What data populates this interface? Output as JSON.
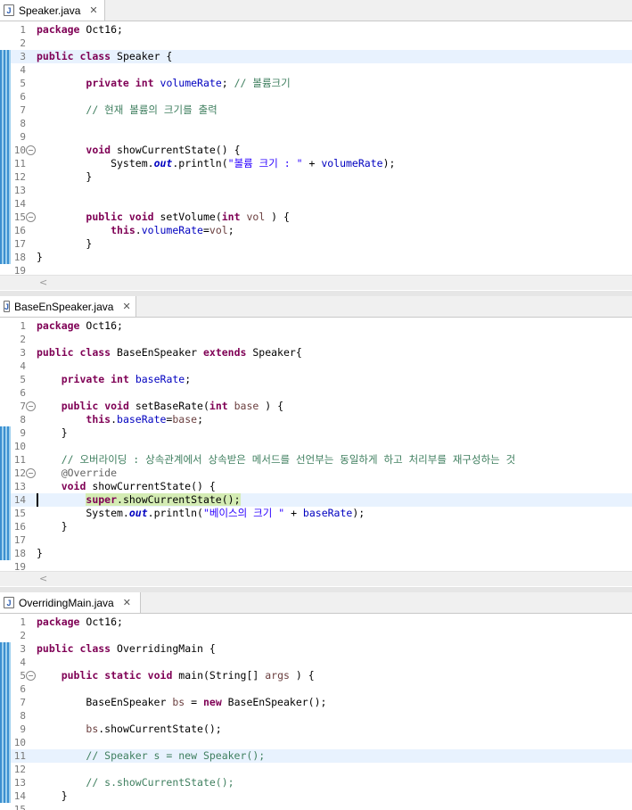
{
  "editors": [
    {
      "tab": "Speaker.java",
      "lines": [
        {
          "n": "1",
          "parts": [
            [
              "kw",
              "package"
            ],
            [
              "",
              "&nbsp;Oct16;"
            ]
          ]
        },
        {
          "n": "2",
          "parts": []
        },
        {
          "n": "3",
          "hl": true,
          "parts": [
            [
              "kw",
              "public"
            ],
            [
              "",
              " "
            ],
            [
              "kw",
              "class"
            ],
            [
              "",
              " Speaker {"
            ]
          ]
        },
        {
          "n": "4",
          "parts": []
        },
        {
          "n": "5",
          "parts": [
            [
              "",
              "        "
            ],
            [
              "kw",
              "private"
            ],
            [
              "",
              " "
            ],
            [
              "kw",
              "int"
            ],
            [
              "",
              " "
            ],
            [
              "fld",
              "volumeRate"
            ],
            [
              "",
              "; "
            ],
            [
              "cm",
              "// 볼륨크기"
            ]
          ]
        },
        {
          "n": "6",
          "parts": []
        },
        {
          "n": "7",
          "parts": [
            [
              "",
              "        "
            ],
            [
              "cm",
              "// 현재 볼륨의 크기를 출력"
            ]
          ]
        },
        {
          "n": "8",
          "parts": []
        },
        {
          "n": "9",
          "parts": []
        },
        {
          "n": "10",
          "fold": true,
          "parts": [
            [
              "",
              "        "
            ],
            [
              "kw",
              "void"
            ],
            [
              "",
              " showCurrentState() {"
            ]
          ]
        },
        {
          "n": "11",
          "parts": [
            [
              "",
              "            System."
            ],
            [
              "st",
              "out"
            ],
            [
              "",
              ".println("
            ],
            [
              "str",
              "\"볼륨 크기 : \""
            ],
            [
              "",
              " + "
            ],
            [
              "fld",
              "volumeRate"
            ],
            [
              "",
              ");"
            ]
          ]
        },
        {
          "n": "12",
          "parts": [
            [
              "",
              "        }"
            ]
          ]
        },
        {
          "n": "13",
          "parts": []
        },
        {
          "n": "14",
          "parts": []
        },
        {
          "n": "15",
          "fold": true,
          "parts": [
            [
              "",
              "        "
            ],
            [
              "kw",
              "public"
            ],
            [
              "",
              " "
            ],
            [
              "kw",
              "void"
            ],
            [
              "",
              " setVolume("
            ],
            [
              "kw",
              "int"
            ],
            [
              "",
              " "
            ],
            [
              "var",
              "vol"
            ],
            [
              "",
              " ) {"
            ]
          ]
        },
        {
          "n": "16",
          "parts": [
            [
              "",
              "            "
            ],
            [
              "kw",
              "this"
            ],
            [
              "",
              "."
            ],
            [
              "fld",
              "volumeRate"
            ],
            [
              "",
              "="
            ],
            [
              "var",
              "vol"
            ],
            [
              "",
              ";"
            ]
          ]
        },
        {
          "n": "17",
          "parts": [
            [
              "",
              "        }"
            ]
          ]
        },
        {
          "n": "18",
          "parts": [
            [
              "",
              "}"
            ]
          ]
        },
        {
          "n": "19",
          "parts": []
        }
      ]
    },
    {
      "tab": "BaseEnSpeaker.java",
      "lines": [
        {
          "n": "1",
          "parts": [
            [
              "kw",
              "package"
            ],
            [
              "",
              " Oct16;"
            ]
          ]
        },
        {
          "n": "2",
          "parts": []
        },
        {
          "n": "3",
          "parts": [
            [
              "kw",
              "public"
            ],
            [
              "",
              " "
            ],
            [
              "kw",
              "class"
            ],
            [
              "",
              " BaseEnSpeaker "
            ],
            [
              "kw",
              "extends"
            ],
            [
              "",
              " Speaker{"
            ]
          ]
        },
        {
          "n": "4",
          "parts": []
        },
        {
          "n": "5",
          "parts": [
            [
              "",
              "    "
            ],
            [
              "kw",
              "private"
            ],
            [
              "",
              " "
            ],
            [
              "kw",
              "int"
            ],
            [
              "",
              " "
            ],
            [
              "fld",
              "baseRate"
            ],
            [
              "",
              ";"
            ]
          ]
        },
        {
          "n": "6",
          "parts": []
        },
        {
          "n": "7",
          "fold": true,
          "parts": [
            [
              "",
              "    "
            ],
            [
              "kw",
              "public"
            ],
            [
              "",
              " "
            ],
            [
              "kw",
              "void"
            ],
            [
              "",
              " setBaseRate("
            ],
            [
              "kw",
              "int"
            ],
            [
              "",
              " "
            ],
            [
              "var",
              "base"
            ],
            [
              "",
              " ) {"
            ]
          ]
        },
        {
          "n": "8",
          "parts": [
            [
              "",
              "        "
            ],
            [
              "kw",
              "this"
            ],
            [
              "",
              "."
            ],
            [
              "fld",
              "baseRate"
            ],
            [
              "",
              "="
            ],
            [
              "var",
              "base"
            ],
            [
              "",
              ";"
            ]
          ]
        },
        {
          "n": "9",
          "parts": [
            [
              "",
              "    }"
            ]
          ]
        },
        {
          "n": "10",
          "parts": []
        },
        {
          "n": "11",
          "parts": [
            [
              "",
              "    "
            ],
            [
              "cm",
              "// 오버라이딩 : 상속관계에서 상속받은 메서드를 선언부는 동일하게 하고 처리부를 재구성하는 것"
            ]
          ]
        },
        {
          "n": "12",
          "fold": true,
          "parts": [
            [
              "",
              "    "
            ],
            [
              "ann",
              "@Override"
            ]
          ]
        },
        {
          "n": "13",
          "parts": [
            [
              "",
              "    "
            ],
            [
              "kw",
              "void"
            ],
            [
              "",
              " showCurrentState() {"
            ]
          ]
        },
        {
          "n": "14",
          "hl": true,
          "caret": true,
          "parts": [
            [
              "",
              "        "
            ],
            [
              "kw sel",
              "super"
            ],
            [
              "sel",
              ".showCurrentState();"
            ]
          ]
        },
        {
          "n": "15",
          "parts": [
            [
              "",
              "        System."
            ],
            [
              "st",
              "out"
            ],
            [
              "",
              ".println("
            ],
            [
              "str",
              "\"베이스의 크기 \""
            ],
            [
              "",
              " + "
            ],
            [
              "fld",
              "baseRate"
            ],
            [
              "",
              ");"
            ]
          ]
        },
        {
          "n": "16",
          "parts": [
            [
              "",
              "    }"
            ]
          ]
        },
        {
          "n": "17",
          "parts": []
        },
        {
          "n": "18",
          "parts": [
            [
              "",
              "}"
            ]
          ]
        },
        {
          "n": "19",
          "parts": []
        }
      ]
    },
    {
      "tab": "OverridingMain.java",
      "lines": [
        {
          "n": "1",
          "parts": [
            [
              "kw",
              "package"
            ],
            [
              "",
              " Oct16;"
            ]
          ]
        },
        {
          "n": "2",
          "parts": []
        },
        {
          "n": "3",
          "parts": [
            [
              "kw",
              "public"
            ],
            [
              "",
              " "
            ],
            [
              "kw",
              "class"
            ],
            [
              "",
              " OverridingMain {"
            ]
          ]
        },
        {
          "n": "4",
          "parts": []
        },
        {
          "n": "5",
          "fold": true,
          "parts": [
            [
              "",
              "    "
            ],
            [
              "kw",
              "public"
            ],
            [
              "",
              " "
            ],
            [
              "kw",
              "static"
            ],
            [
              "",
              " "
            ],
            [
              "kw",
              "void"
            ],
            [
              "",
              " main(String[] "
            ],
            [
              "var",
              "args"
            ],
            [
              "",
              " ) {"
            ]
          ]
        },
        {
          "n": "6",
          "parts": []
        },
        {
          "n": "7",
          "parts": [
            [
              "",
              "        BaseEnSpeaker "
            ],
            [
              "var",
              "bs"
            ],
            [
              "",
              " = "
            ],
            [
              "kw",
              "new"
            ],
            [
              "",
              " BaseEnSpeaker();"
            ]
          ]
        },
        {
          "n": "8",
          "parts": []
        },
        {
          "n": "9",
          "parts": [
            [
              "",
              "        "
            ],
            [
              "var",
              "bs"
            ],
            [
              "",
              ".showCurrentState();"
            ]
          ]
        },
        {
          "n": "10",
          "parts": []
        },
        {
          "n": "11",
          "hl": true,
          "parts": [
            [
              "",
              "        "
            ],
            [
              "cm",
              "// Speaker s = new Speaker();"
            ]
          ]
        },
        {
          "n": "12",
          "parts": []
        },
        {
          "n": "13",
          "parts": [
            [
              "",
              "        "
            ],
            [
              "cm",
              "// s.showCurrentState();"
            ]
          ]
        },
        {
          "n": "14",
          "parts": [
            [
              "",
              "    }"
            ]
          ]
        },
        {
          "n": "15",
          "parts": []
        }
      ]
    }
  ],
  "icons": {
    "file": "java-file-icon",
    "close": "close-icon",
    "fold": "fold-collapse-icon",
    "scroll": "scroll-left-icon"
  },
  "colors": {
    "keyword": "#7f0055",
    "field": "#0000c0",
    "string": "#2a00ff",
    "comment": "#3f7f5f",
    "annotation": "#646464",
    "current_line": "#e8f2fe",
    "selection": "#d4ecb4",
    "change_bar": "#3b8fd0"
  }
}
